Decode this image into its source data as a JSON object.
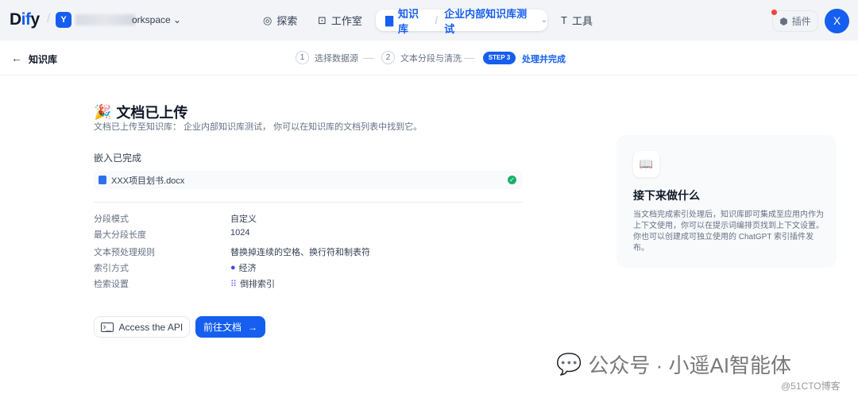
{
  "header": {
    "logo": "Dify",
    "workspace_initial": "Y",
    "workspace_name": "orkspace",
    "nav": {
      "explore": "探索",
      "studio": "工作室",
      "knowledge": "知识库",
      "dataset": "企业内部知识库测试",
      "tools": "工具"
    },
    "plugins": "插件",
    "user_initial": "X"
  },
  "subheader": {
    "back_label": "知识库",
    "steps": [
      {
        "num": "1",
        "label": "选择数据源"
      },
      {
        "num": "2",
        "label": "文本分段与清洗"
      },
      {
        "num": "STEP 3",
        "label": "处理并完成"
      }
    ]
  },
  "main": {
    "title": "文档已上传",
    "description": "文档已上传至知识库： 企业内部知识库测试， 你可以在知识库的文档列表中找到它。",
    "embed_status": "嵌入已完成",
    "file_name": "XXX项目划书.docx",
    "settings": [
      {
        "label": "分段模式",
        "value": "自定义"
      },
      {
        "label": "最大分段长度",
        "value": "1024"
      },
      {
        "label": "文本预处理规则",
        "value": "替换掉连续的空格、换行符和制表符"
      },
      {
        "label": "索引方式",
        "value": "经济"
      },
      {
        "label": "检索设置",
        "value": "倒排索引"
      }
    ],
    "api_button": "Access the API",
    "goto_button": "前往文档"
  },
  "card": {
    "title": "接下来做什么",
    "text": "当文档完成索引处理后，知识库即可集成至应用内作为上下文使用，你可以在提示词编排页找到上下文设置。你也可以创建成可独立使用的 ChatGPT 索引插件发布。"
  },
  "watermark": {
    "main": "公众号 · 小遥AI智能体",
    "sub": "@51CTO博客"
  }
}
